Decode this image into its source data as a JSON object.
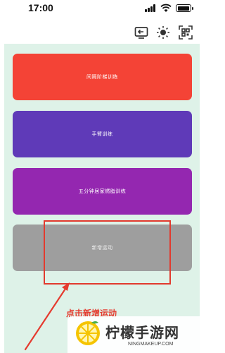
{
  "status_bar": {
    "time": "17:00"
  },
  "toolbar": {
    "icons": [
      "cast-icon",
      "brightness-icon",
      "qr-scan-icon"
    ]
  },
  "workouts": [
    {
      "label": "间隔阶梯训练",
      "color": "#f44336"
    },
    {
      "label": "手臂训练",
      "color": "#5f3ab8"
    },
    {
      "label": "五分钟居家燃脂训练",
      "color": "#9427b0"
    },
    {
      "label": "新增运动",
      "color": "#9e9e9e"
    }
  ],
  "annotation": {
    "hint": "点击新增运动",
    "highlight_color": "#e23a2e"
  },
  "watermark": {
    "title": "柠檬手游网",
    "url": "NINGMAKEUP.COM"
  },
  "colors": {
    "background": "#def2e8"
  }
}
